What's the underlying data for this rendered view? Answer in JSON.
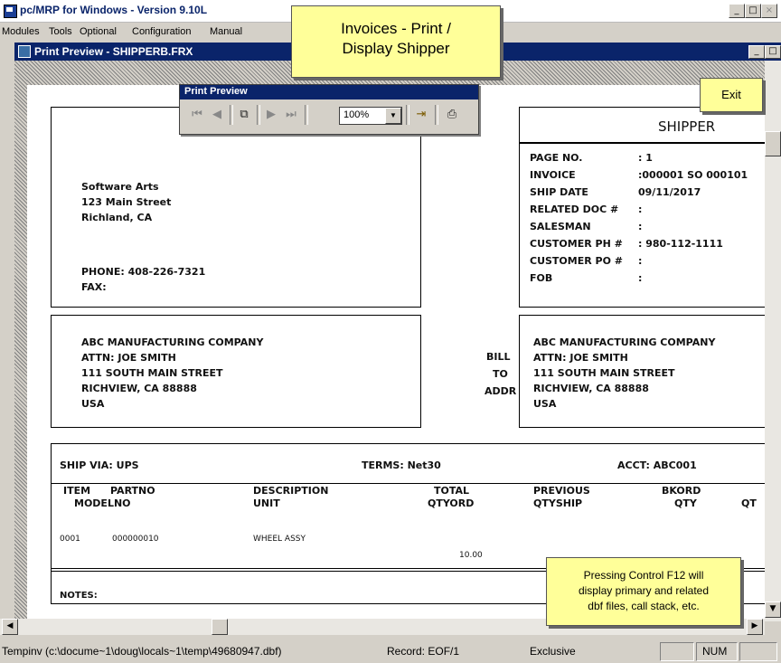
{
  "app": {
    "title": "pc/MRP for Windows - Version 9.10L"
  },
  "menu": [
    "Modules",
    "Tools",
    "Optional",
    "Configuration",
    "Manual"
  ],
  "child": {
    "title": "Print Preview - SHIPPERB.FRX"
  },
  "toolbar": {
    "title": "Print Preview",
    "zoom": "100%"
  },
  "callouts": {
    "main": "Invoices - Print /\nDisplay Shipper",
    "exit": "Exit",
    "ctrl": "Pressing Control F12 will\ndisplay primary and related\ndbf files, call stack, etc."
  },
  "report": {
    "shipper_title": "SHIPPER",
    "company": [
      "Software Arts",
      "123 Main Street",
      "Richland, CA"
    ],
    "phone": "PHONE: 408-226-7321",
    "fax": "FAX:",
    "info_labels": [
      "PAGE NO.",
      "INVOICE",
      "SHIP DATE",
      "RELATED DOC #",
      "SALESMAN",
      "CUSTOMER PH #",
      "CUSTOMER PO #",
      "FOB"
    ],
    "info_values": [
      ": 1",
      ":000001 SO 000101",
      "09/11/2017",
      ":",
      ":",
      ": 980-112-1111",
      ":",
      ":"
    ],
    "ship_to": [
      "ABC MANUFACTURING COMPANY",
      "ATTN: JOE SMITH",
      "111 SOUTH MAIN STREET",
      "RICHVIEW, CA 88888",
      "USA"
    ],
    "bill_label": [
      "BILL",
      "TO",
      "ADDR"
    ],
    "bill_to": [
      "ABC MANUFACTURING COMPANY",
      "ATTN: JOE SMITH",
      "111 SOUTH MAIN STREET",
      "RICHVIEW, CA 88888",
      "USA"
    ],
    "ship_via": "SHIP VIA: UPS",
    "terms": "TERMS: Net30",
    "acct": "ACCT: ABC001",
    "col_headers": {
      "item": "ITEM",
      "partno": "PARTNO",
      "modelno": "MODELNO",
      "description": "DESCRIPTION",
      "unit": "UNIT",
      "total": "TOTAL",
      "qtyord": "QTYORD",
      "previous": "PREVIOUS",
      "qtyship": "QTYSHIP",
      "bkord": "BKORD",
      "qty": "QTY",
      "qt": "QT"
    },
    "line": {
      "item": "0001",
      "partno": "000000010",
      "description": "WHEEL ASSY",
      "qty": "10.00"
    },
    "notes": "NOTES:"
  },
  "status": {
    "file": "Tempinv (c:\\docume~1\\doug\\locals~1\\temp\\49680947.dbf)",
    "record": "Record: EOF/1",
    "mode": "Exclusive",
    "num": "NUM"
  }
}
